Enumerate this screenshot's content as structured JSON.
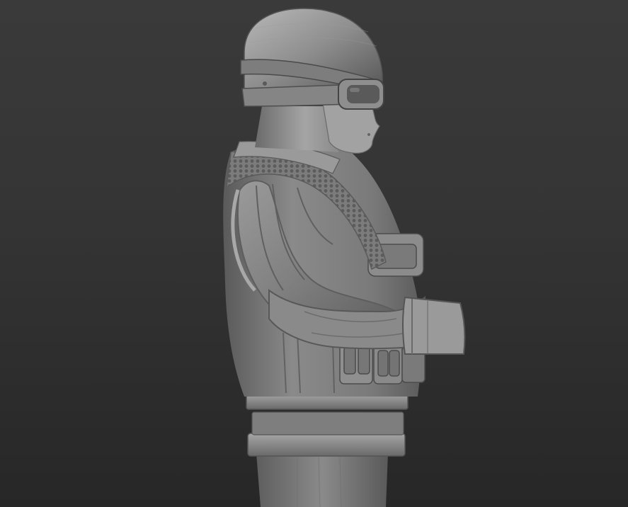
{
  "scene": {
    "description_visible_text": "",
    "background_top_color": "#3a3a3a",
    "background_bottom_color": "#272727",
    "model_base_color": "#8c8c8c",
    "model_highlight_color": "#b4b4b4",
    "model_shadow_color": "#4a4a4a",
    "subject": "clay-render-soldier-bust-side-view"
  }
}
